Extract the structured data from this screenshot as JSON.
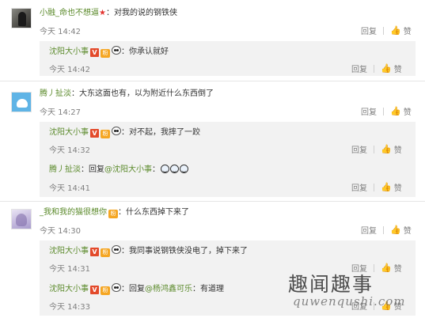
{
  "actions": {
    "reply": "回复",
    "like": "赞"
  },
  "comments": [
    {
      "user": "小融_命也不想逼",
      "text": "对我的说的钢铁侠",
      "time": "今天 14:42",
      "replies": [
        {
          "user": "沈阳大小事",
          "text": "你承认就好",
          "time": "今天 14:42"
        }
      ]
    },
    {
      "user": "腾丿扯淡",
      "text": "大东这面也有，以为附近什么东西倒了",
      "time": "今天 14:27",
      "replies": [
        {
          "user": "沈阳大小事",
          "text": "对不起，我摔了一跤",
          "time": "今天 14:32"
        },
        {
          "user": "腾丿扯淡",
          "reply_prefix": "回复",
          "mention": "@沈阳大小事",
          "text": "",
          "time": "今天 14:41"
        }
      ]
    },
    {
      "user": "_我和我的猫很想你",
      "text": "什么东西掉下来了",
      "time": "今天 14:30",
      "replies": [
        {
          "user": "沈阳大小事",
          "text": "我同事说钢铁侠没电了，掉下来了",
          "time": "今天 14:31"
        },
        {
          "user": "沈阳大小事",
          "reply_prefix": "回复",
          "mention": "@杨鸿鑫可乐",
          "text": "有道理",
          "time": "今天 14:33"
        }
      ]
    }
  ],
  "badges": {
    "verified": "V",
    "fan": "粉",
    "star": "★"
  },
  "separator": "：",
  "watermark": {
    "cn": "趣闻趣事",
    "en": "quwenqushi.com"
  }
}
